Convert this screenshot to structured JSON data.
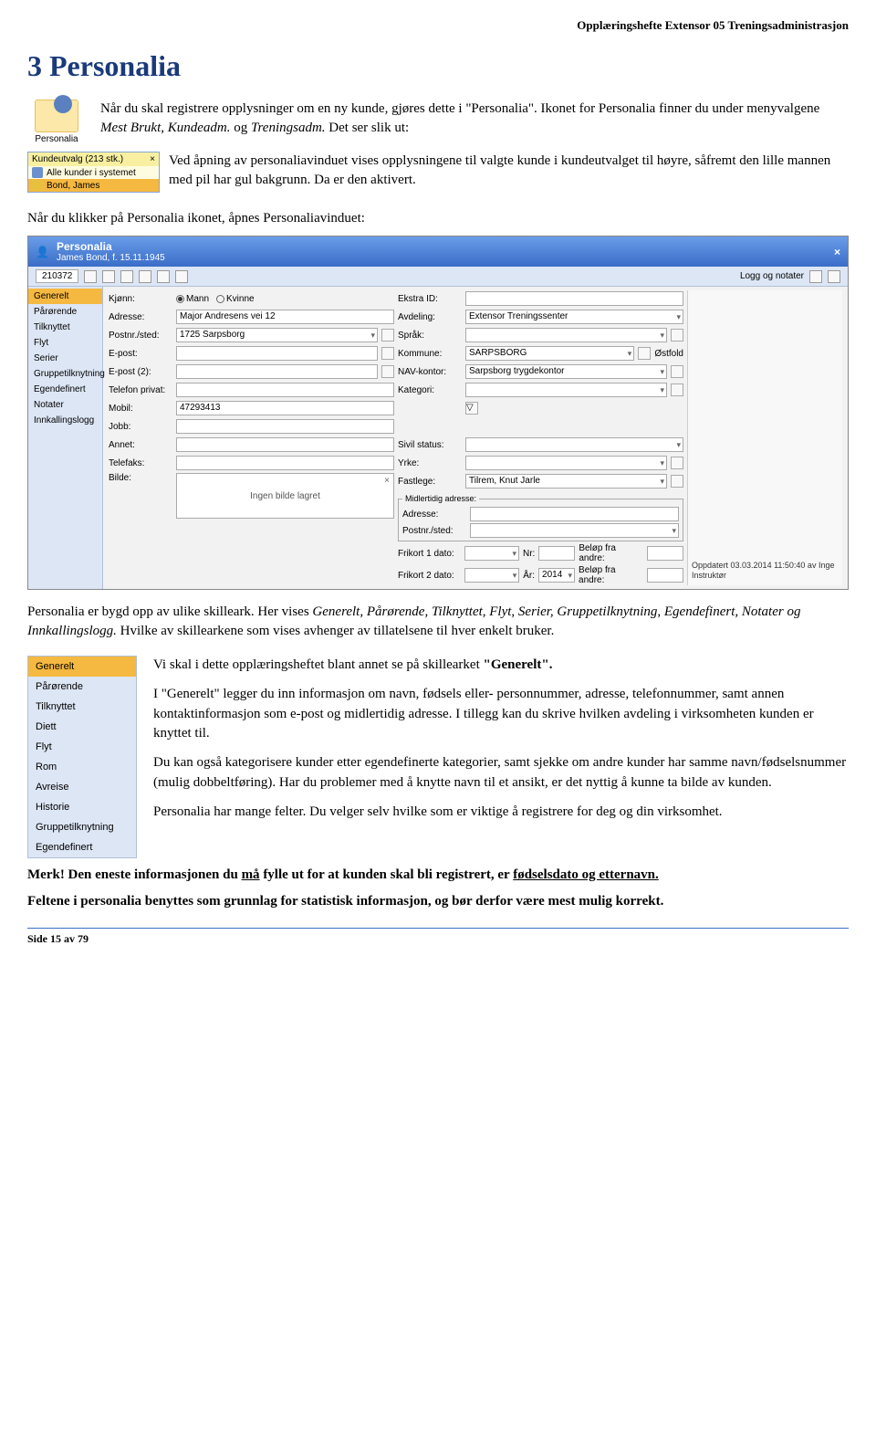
{
  "header": "Opplæringshefte Extensor 05 Treningsadministrasjon",
  "h1": "3 Personalia",
  "intro1a": "Når du skal registrere opplysninger om en ny kunde, gjøres dette i \"Personalia\". Ikonet for Personalia finner du under menyvalgene ",
  "intro1b": "Mest Brukt, Kundeadm.",
  "intro1c": " og ",
  "intro1d": "Treningsadm.",
  "intro1e": " Det ser slik ut:",
  "personalia_caption": "Personalia",
  "kunde": {
    "title": "Kundeutvalg (213 stk.)",
    "item1": "Alle kunder i systemet",
    "item2": "Bond, James"
  },
  "intro2": "Ved åpning av personaliavinduet vises opplysningene til valgte kunde i kundeutvalget til høyre, såfremt den lille mannen med pil har gul bakgrunn. Da er den aktivert.",
  "para2": "Når du klikker på Personalia ikonet, åpnes Personaliavinduet:",
  "ss": {
    "title": "Personalia",
    "subtitle": "James Bond, f. 15.11.1945",
    "id": "210372",
    "log_label": "Logg og notater",
    "side": [
      "Generelt",
      "Pårørende",
      "Tilknyttet",
      "Flyt",
      "Serier",
      "Gruppetilknytning",
      "Egendefinert",
      "Notater",
      "Innkallingslogg"
    ],
    "labels": {
      "kjonn": "Kjønn:",
      "mann": "Mann",
      "kvinne": "Kvinne",
      "adresse": "Adresse:",
      "postnr": "Postnr./sted:",
      "epost": "E-post:",
      "epost2": "E-post (2):",
      "telpriv": "Telefon privat:",
      "mobil": "Mobil:",
      "jobb": "Jobb:",
      "annet": "Annet:",
      "telefaks": "Telefaks:",
      "bilde": "Bilde:",
      "ingen_bilde": "Ingen bilde lagret",
      "ekstraid": "Ekstra ID:",
      "avdeling": "Avdeling:",
      "sprak": "Språk:",
      "kommune": "Kommune:",
      "nav": "NAV-kontor:",
      "kategori": "Kategori:",
      "sivil": "Sivil status:",
      "yrke": "Yrke:",
      "fastlege": "Fastlege:",
      "midl": "Midlertidig adresse:",
      "adresse2": "Adresse:",
      "postnr2": "Postnr./sted:",
      "frikort1": "Frikort 1 dato:",
      "frikort2": "Frikort 2 dato:",
      "nr": "Nr:",
      "ar": "År:",
      "belop": "Beløp fra andre:",
      "ostfold": "Østfold"
    },
    "vals": {
      "adresse": "Major Andresens vei 12",
      "postnr": "1725 Sarpsborg",
      "mobil": "47293413",
      "avdeling": "Extensor Treningssenter",
      "kommune": "SARPSBORG",
      "nav": "Sarpsborg trygdekontor",
      "fastlege": "Tilrem, Knut Jarle",
      "ar": "2014"
    },
    "updated": "Oppdatert 03.03.2014 11:50:40 av Inge Instruktør"
  },
  "para3a": "Personalia er bygd opp av ulike skilleark. Her vises ",
  "para3b": "Generelt, Pårørende, Tilknyttet, Flyt, Serier, Gruppetilknytning, Egendefinert, Notater og Innkallingslogg.",
  "para3c": " Hvilke av skillearkene som vises avhenger av tillatelsene til hver enkelt bruker.",
  "tabs2": [
    "Generelt",
    "Pårørende",
    "Tilknyttet",
    "Diett",
    "Flyt",
    "Rom",
    "Avreise",
    "Historie",
    "Gruppetilknytning",
    "Egendefinert"
  ],
  "s1a": "Vi skal i dette opplæringsheftet blant annet se på skillearket ",
  "s1b": "\"Generelt\".",
  "s2": "I \"Generelt\" legger du inn informasjon om navn, fødsels eller- personnummer, adresse, telefonnummer, samt annen kontaktinformasjon som e-post og midlertidig adresse. I tillegg kan du skrive hvilken avdeling i virksomheten kunden er knyttet til.",
  "s3": "Du kan også kategorisere kunder etter egendefinerte kategorier, samt sjekke om andre kunder har samme navn/fødselsnummer (mulig dobbeltføring). Har du problemer med å knytte navn til et ansikt, er det nyttig å kunne ta bilde av kunden.",
  "s4": "Personalia har mange felter. Du velger selv hvilke som er viktige å registrere for deg og din virksomhet.",
  "merk1a": "Merk! Den eneste informasjonen du ",
  "merk1b": "må",
  "merk1c": " fylle ut for at kunden skal bli registrert, er ",
  "merk1d": "fødselsdato og etternavn.",
  "merk2": "Feltene i personalia benyttes som grunnlag for statistisk informasjon, og bør derfor være mest mulig korrekt.",
  "footer": "Side 15 av 79"
}
